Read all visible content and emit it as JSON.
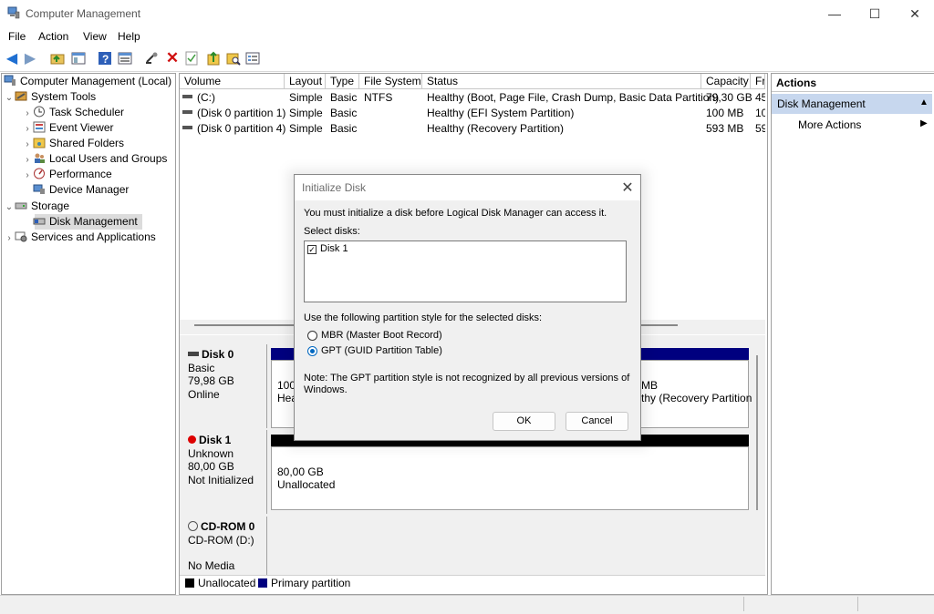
{
  "window": {
    "title": "Computer Management",
    "controls": {
      "minimize": "—",
      "maximize": "☐",
      "close": "✕"
    }
  },
  "menu": [
    "File",
    "Action",
    "View",
    "Help"
  ],
  "toolbar_icons": [
    "back-arrow-icon",
    "forward-arrow-icon",
    "up-folder-icon",
    "show-hide-console-tree-icon",
    "help-icon",
    "properties-icon",
    "connect-icon",
    "delete-icon",
    "check-icon",
    "export-icon",
    "folder-search-icon",
    "list-icon"
  ],
  "tree": {
    "root": "Computer Management (Local)",
    "system_tools": "System Tools",
    "task_scheduler": "Task Scheduler",
    "event_viewer": "Event Viewer",
    "shared_folders": "Shared Folders",
    "local_users": "Local Users and Groups",
    "performance": "Performance",
    "device_manager": "Device Manager",
    "storage": "Storage",
    "disk_management": "Disk Management",
    "services": "Services and Applications"
  },
  "volumes": {
    "headers": [
      "Volume",
      "Layout",
      "Type",
      "File System",
      "Status",
      "Capacity",
      "Fr"
    ],
    "rows": [
      {
        "volume": "(C:)",
        "layout": "Simple",
        "type": "Basic",
        "fs": "NTFS",
        "status": "Healthy (Boot, Page File, Crash Dump, Basic Data Partition)",
        "capacity": "79,30 GB",
        "free": "45"
      },
      {
        "volume": "(Disk 0 partition 1)",
        "layout": "Simple",
        "type": "Basic",
        "fs": "",
        "status": "Healthy (EFI System Partition)",
        "capacity": "100 MB",
        "free": "10"
      },
      {
        "volume": "(Disk 0 partition 4)",
        "layout": "Simple",
        "type": "Basic",
        "fs": "",
        "status": "Healthy (Recovery Partition)",
        "capacity": "593 MB",
        "free": "59"
      }
    ]
  },
  "disks": {
    "disk0": {
      "name": "Disk 0",
      "kind": "Basic",
      "size": "79,98 GB",
      "state": "Online",
      "part_left_1": "100",
      "part_left_2": "Hea",
      "part_right_1": "MB",
      "part_right_2": "thy (Recovery Partition"
    },
    "disk1": {
      "name": "Disk 1",
      "kind": "Unknown",
      "size": "80,00 GB",
      "state": "Not Initialized",
      "part_size": "80,00 GB",
      "part_state": "Unallocated"
    },
    "cdrom": {
      "name": "CD-ROM 0",
      "drive": "CD-ROM (D:)",
      "media": "No Media"
    }
  },
  "legend": {
    "unallocated": "Unallocated",
    "primary": "Primary partition",
    "unallocated_color": "#000000",
    "primary_color": "#00007f"
  },
  "actions": {
    "header": "Actions",
    "section": "Disk Management",
    "more": "More Actions"
  },
  "dialog": {
    "title": "Initialize Disk",
    "message": "You must initialize a disk before Logical Disk Manager can access it.",
    "select_label": "Select disks:",
    "disks": [
      {
        "label": "Disk 1",
        "checked": true
      }
    ],
    "style_label": "Use the following partition style for the selected disks:",
    "options": [
      {
        "label": "MBR (Master Boot Record)",
        "selected": false
      },
      {
        "label": "GPT (GUID Partition Table)",
        "selected": true
      }
    ],
    "note_1": "Note: The GPT partition style is not recognized by all previous versions of",
    "note_2": "Windows.",
    "ok": "OK",
    "cancel": "Cancel"
  }
}
